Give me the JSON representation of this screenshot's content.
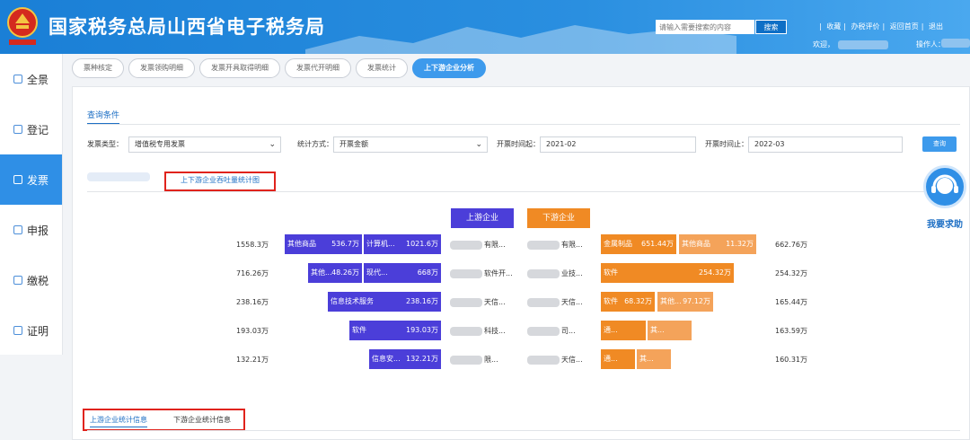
{
  "header": {
    "title": "国家税务总局山西省电子税务局",
    "search_placeholder": "请输入需要搜索的内容",
    "search_button": "搜索",
    "links": [
      "收藏",
      "办税评价",
      "返回首页",
      "退出"
    ],
    "welcome": "欢迎，",
    "operator": "操作人："
  },
  "sidebar": {
    "items": [
      {
        "label": "全景"
      },
      {
        "label": "登记"
      },
      {
        "label": "发票"
      },
      {
        "label": "申报"
      },
      {
        "label": "缴税"
      },
      {
        "label": "证明"
      }
    ],
    "active_index": 2
  },
  "tabs": [
    "票种核定",
    "发票领购明细",
    "发票开具取得明细",
    "发票代开明细",
    "发票统计",
    "上下游企业分析"
  ],
  "query": {
    "section_title": "查询条件",
    "invoice_type_label": "发票类型：",
    "invoice_type_value": "增值税专用发票",
    "stat_method_label": "统计方式：",
    "stat_method_value": "开票金额",
    "start_label": "开票时间起：",
    "start_value": "2021-02",
    "end_label": "开票时间止：",
    "end_value": "2022-03",
    "query_button": "查询"
  },
  "subtab": "上下游企业吞吐量统计图",
  "legend": {
    "up": "上游企业",
    "down": "下游企业"
  },
  "rows": [
    {
      "left_total": "1558.3万",
      "up": [
        {
          "label": "其他商品",
          "value": "536.7万"
        },
        {
          "label": "计算机...",
          "value": "1021.6万"
        }
      ],
      "up_name": "有限...",
      "down_name": "有限...",
      "down": [
        {
          "label": "金属制品",
          "value": "651.44万"
        },
        {
          "label": "其他商品",
          "value": "11.32万"
        }
      ],
      "right_total": "662.76万"
    },
    {
      "left_total": "716.26万",
      "up": [
        {
          "label": "其他...",
          "value": "48.26万"
        },
        {
          "label": "现代...",
          "value": "668万"
        }
      ],
      "up_name": "软件开...",
      "down_name": "业技...",
      "down": [
        {
          "label": "软件",
          "value": "254.32万"
        }
      ],
      "right_total": "254.32万"
    },
    {
      "left_total": "238.16万",
      "up": [
        {
          "label": "信息技术服务",
          "value": "238.16万"
        }
      ],
      "up_name": "天信...",
      "down_name": "天信...",
      "down": [
        {
          "label": "软件",
          "value": "68.32万"
        },
        {
          "label": "其他...",
          "value": "97.12万"
        }
      ],
      "right_total": "165.44万"
    },
    {
      "left_total": "193.03万",
      "up": [
        {
          "label": "软件",
          "value": "193.03万"
        }
      ],
      "up_name": "科技...",
      "down_name": "司...",
      "down": [
        {
          "label": "通...",
          "value": ""
        },
        {
          "label": "其...",
          "value": ""
        }
      ],
      "right_total": "163.59万"
    },
    {
      "left_total": "132.21万",
      "up": [
        {
          "label": "信息安...",
          "value": "132.21万"
        }
      ],
      "up_name": "限...",
      "down_name": "天信...",
      "down": [
        {
          "label": "通...",
          "value": ""
        },
        {
          "label": "其...",
          "value": ""
        }
      ],
      "right_total": "160.31万"
    }
  ],
  "bottom_tabs": [
    "上游企业统计信息",
    "下游企业统计信息"
  ],
  "help": "我要求助",
  "colors": {
    "upstream": "#4b3ed9",
    "downstream": "#f08a24",
    "accent": "#3d9aec",
    "highlight": "#e0231c"
  }
}
